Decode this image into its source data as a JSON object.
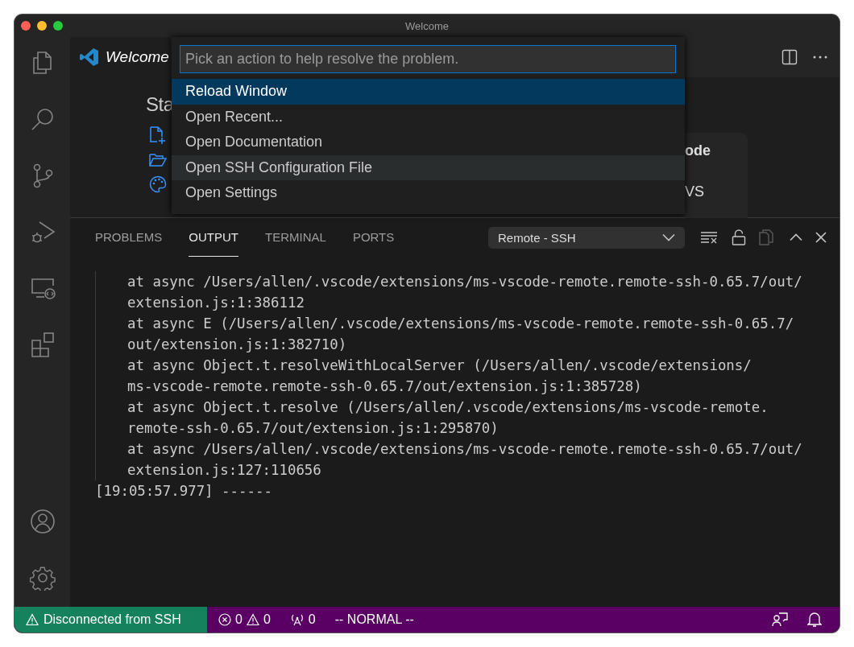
{
  "window": {
    "title": "Welcome"
  },
  "editor": {
    "tab": {
      "label": "Welcome"
    },
    "heading": "Sta",
    "card": [
      "ode",
      "VS"
    ]
  },
  "quick_pick": {
    "placeholder": "Pick an action to help resolve the problem.",
    "items": [
      {
        "label": "Reload Window",
        "selected": true,
        "hovered": false
      },
      {
        "label": "Open Recent...",
        "selected": false,
        "hovered": false
      },
      {
        "label": "Open Documentation",
        "selected": false,
        "hovered": false
      },
      {
        "label": "Open SSH Configuration File",
        "selected": false,
        "hovered": true
      },
      {
        "label": "Open Settings",
        "selected": false,
        "hovered": false
      }
    ]
  },
  "panel": {
    "tabs": [
      {
        "label": "PROBLEMS",
        "selected": false
      },
      {
        "label": "OUTPUT",
        "selected": true
      },
      {
        "label": "TERMINAL",
        "selected": false
      },
      {
        "label": "PORTS",
        "selected": false
      }
    ],
    "channel": "Remote - SSH",
    "lines": [
      {
        "text": "at async /Users/allen/.vscode/extensions/ms-vscode-remote.remote-ssh-0.65.7/out/",
        "indented": true
      },
      {
        "text": "extension.js:1:386112",
        "indented": true
      },
      {
        "text": "at async E (/Users/allen/.vscode/extensions/ms-vscode-remote.remote-ssh-0.65.7/",
        "indented": true
      },
      {
        "text": "out/extension.js:1:382710)",
        "indented": true
      },
      {
        "text": "at async Object.t.resolveWithLocalServer (/Users/allen/.vscode/extensions/",
        "indented": true
      },
      {
        "text": "ms-vscode-remote.remote-ssh-0.65.7/out/extension.js:1:385728)",
        "indented": true
      },
      {
        "text": "at async Object.t.resolve (/Users/allen/.vscode/extensions/ms-vscode-remote.",
        "indented": true
      },
      {
        "text": "remote-ssh-0.65.7/out/extension.js:1:295870)",
        "indented": true
      },
      {
        "text": "at async /Users/allen/.vscode/extensions/ms-vscode-remote.remote-ssh-0.65.7/out/",
        "indented": true
      },
      {
        "text": "extension.js:127:110656",
        "indented": true
      },
      {
        "text": "[19:05:57.977] ------",
        "indented": false
      }
    ]
  },
  "status_bar": {
    "remote": "Disconnected from SSH",
    "errors": "0",
    "warnings": "0",
    "ports": "0",
    "mode": "-- NORMAL --"
  }
}
